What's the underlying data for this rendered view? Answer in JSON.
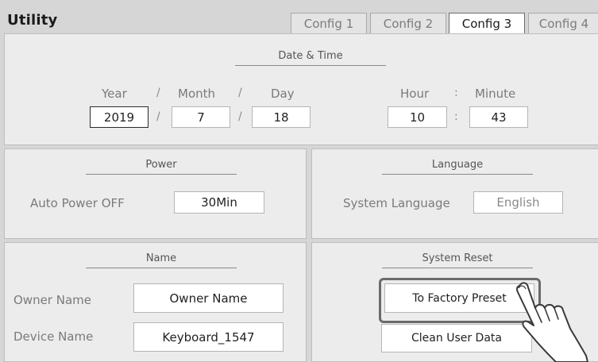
{
  "header": {
    "title": "Utility",
    "tabs": [
      {
        "label": "Config 1",
        "active": false
      },
      {
        "label": "Config 2",
        "active": false
      },
      {
        "label": "Config 3",
        "active": true
      },
      {
        "label": "Config 4",
        "active": false
      }
    ]
  },
  "datetime": {
    "title": "Date & Time",
    "year_label": "Year",
    "month_label": "Month",
    "day_label": "Day",
    "hour_label": "Hour",
    "minute_label": "Minute",
    "date_separator": "/",
    "time_separator": ":",
    "year": "2019",
    "month": "7",
    "day": "18",
    "hour": "10",
    "minute": "43"
  },
  "power": {
    "title": "Power",
    "auto_power_off_label": "Auto Power OFF",
    "auto_power_off_value": "30Min"
  },
  "language": {
    "title": "Language",
    "system_language_label": "System Language",
    "system_language_value": "English"
  },
  "name": {
    "title": "Name",
    "owner_label": "Owner Name",
    "owner_value": "Owner Name",
    "device_label": "Device Name",
    "device_value": "Keyboard_1547"
  },
  "reset": {
    "title": "System Reset",
    "factory_button": "To Factory Preset",
    "clean_button": "Clean User Data"
  },
  "icons": {
    "pointer": "pointing-hand-icon"
  }
}
